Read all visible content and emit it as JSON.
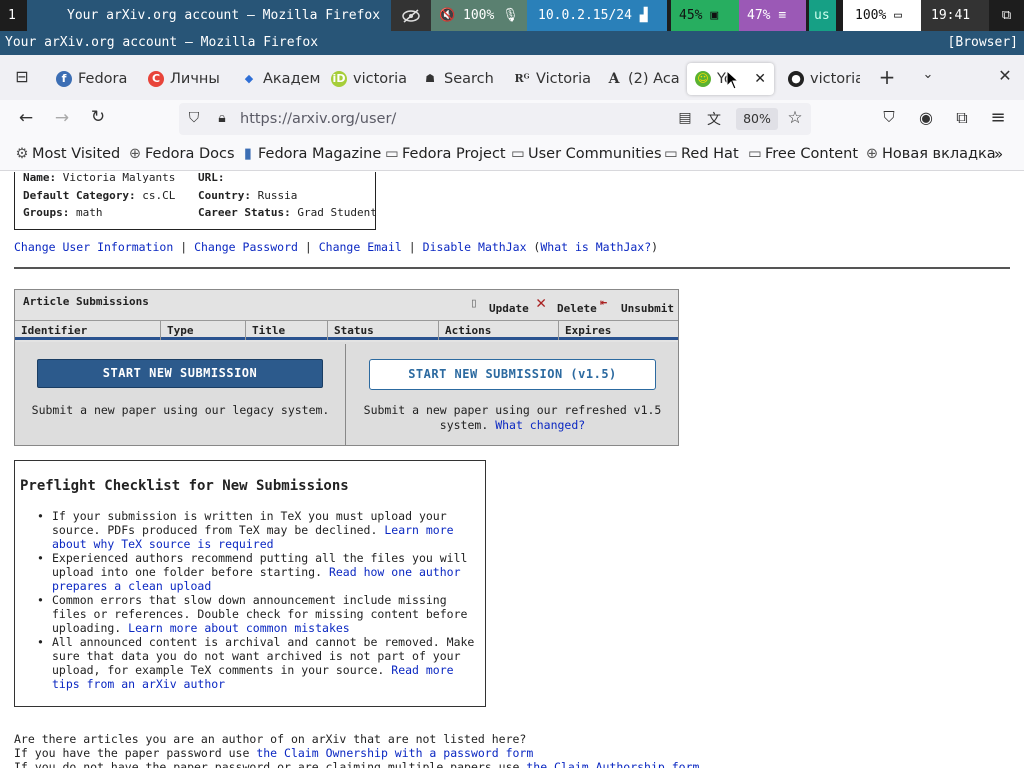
{
  "i3bar": {
    "workspace": "1",
    "window_title": "Your arXiv.org account — Mozilla Firefox",
    "volume": "100%",
    "ip": "10.0.2.15/24",
    "cpu": "45%",
    "mem": "47%",
    "layout": "us",
    "battery": "100%",
    "time": "19:41"
  },
  "i3title": {
    "title": "Your arXiv.org account — Mozilla Firefox",
    "mark": "[Browser]"
  },
  "tabs": [
    {
      "label": "Fedora"
    },
    {
      "label": "Личны"
    },
    {
      "label": "Академ"
    },
    {
      "label": "victoria"
    },
    {
      "label": "Search"
    },
    {
      "label": "Victoria"
    },
    {
      "label": "(2) Aca"
    },
    {
      "label": "Yo"
    },
    {
      "label": "victoria"
    }
  ],
  "navbar": {
    "url": "https://arxiv.org/user/",
    "zoom": "80%"
  },
  "bookmarks": [
    "Most Visited",
    "Fedora Docs",
    "Fedora Magazine",
    "Fedora Project",
    "User Communities",
    "Red Hat",
    "Free Content",
    "Новая вкладка"
  ],
  "user": {
    "name_label": "Name:",
    "name": "Victoria Malyants",
    "url_label": "URL:",
    "url": "",
    "cat_label": "Default Category:",
    "category": "cs.CL",
    "country_label": "Country:",
    "country": "Russia",
    "groups_label": "Groups:",
    "groups": "math",
    "career_label": "Career Status:",
    "career": "Grad Student"
  },
  "user_links": {
    "change_info": "Change User Information",
    "change_password": "Change Password",
    "change_email": "Change Email",
    "disable_mathjax": "Disable MathJax",
    "what_mathjax": "What is MathJax?",
    "sep": "|"
  },
  "submissions": {
    "title": "Article Submissions",
    "update": "Update",
    "delete": "Delete",
    "unsubmit": "Unsubmit",
    "columns": [
      "Identifier",
      "Type",
      "Title",
      "Status",
      "Actions",
      "Expires"
    ],
    "legacy_button": "START NEW SUBMISSION",
    "legacy_desc": "Submit a new paper using our legacy system.",
    "new_button": "START NEW SUBMISSION (v1.5)",
    "new_desc_1": "Submit a new paper using our refreshed v1.5",
    "new_desc_2": "system.",
    "what_changed": "What changed?"
  },
  "checklist": {
    "title": "Preflight Checklist for New Submissions",
    "items": [
      {
        "text": "If your submission is written in TeX you must upload your source. PDFs produced from TeX may be declined. ",
        "link": "Learn more about why TeX source is required"
      },
      {
        "text": "Experienced authors recommend putting all the files you will upload into one folder before starting. ",
        "link": "Read how one author prepares a clean upload"
      },
      {
        "text": "Common errors that slow down announcement include missing files or references. Double check for missing content before uploading. ",
        "link": "Learn more about common mistakes"
      },
      {
        "text": "All announced content is archival and cannot be removed. Make sure that data you do not want archived is not part of your upload, for example TeX comments in your source. ",
        "link": "Read more tips from an arXiv author"
      }
    ]
  },
  "bottom": {
    "line1": "Are there articles you are an author of on arXiv that are not listed here?",
    "line2_text": "If you have the paper password use ",
    "line2_link": "the Claim Ownership with a password form",
    "line3_text": "If you do not have the paper password or are claiming multiple papers use ",
    "line3_link": "the Claim Authorship form"
  },
  "colors": {
    "i3_focus": "#285577",
    "arxiv_button": "#2c5a8c",
    "link": "#0b28c2"
  }
}
